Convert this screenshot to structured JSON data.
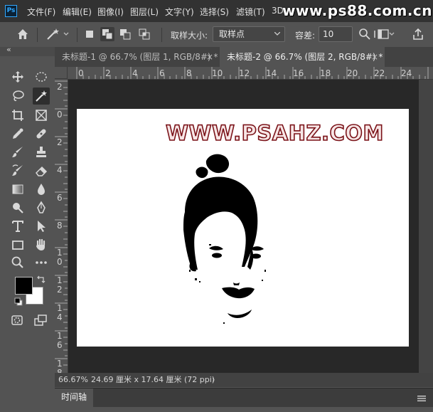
{
  "app": {
    "logo": "Ps"
  },
  "menu": {
    "items": [
      "文件(F)",
      "编辑(E)",
      "图像(I)",
      "图层(L)",
      "文字(Y)",
      "选择(S)",
      "滤镜(T)",
      "3D"
    ],
    "watermark": "www.ps88.com.cn"
  },
  "options": {
    "sample_size_label": "取样大小:",
    "sample_size_value": "取样点",
    "tolerance_label": "容差:",
    "tolerance_value": "10"
  },
  "tabs": [
    {
      "title": "未标题-1 @ 66.7% (图层 1, RGB/8#) *",
      "close": "×",
      "active": false
    },
    {
      "title": "未标题-2 @ 66.7% (图层 2, RGB/8#) *",
      "close": "×",
      "active": true
    }
  ],
  "toolbar": {
    "collapse": "«"
  },
  "ruler": {
    "h_ticks": [
      "0",
      "2",
      "4",
      "6",
      "8",
      "10",
      "12",
      "14",
      "16",
      "18",
      "20",
      "22",
      "24"
    ],
    "v_ticks": [
      "2",
      "0",
      "2",
      "4",
      "6",
      "8",
      "1\n0",
      "1\n2",
      "1\n4",
      "1\n6",
      "1\n8"
    ]
  },
  "canvas": {
    "text": "WWW.PSAHZ.COM",
    "text_fill": "#f7e6e6",
    "text_stroke": "#7a1218"
  },
  "status": {
    "zoom": "66.67%",
    "doc_size": "24.69 厘米 x 17.64 厘米 (72 ppi)",
    "arrow": "›"
  },
  "timeline": {
    "label": "时间轴",
    "menu_icon": "hamburger-icon"
  },
  "colors": {
    "foreground": "#000000",
    "background": "#ffffff",
    "accent": "#31a8ff"
  }
}
